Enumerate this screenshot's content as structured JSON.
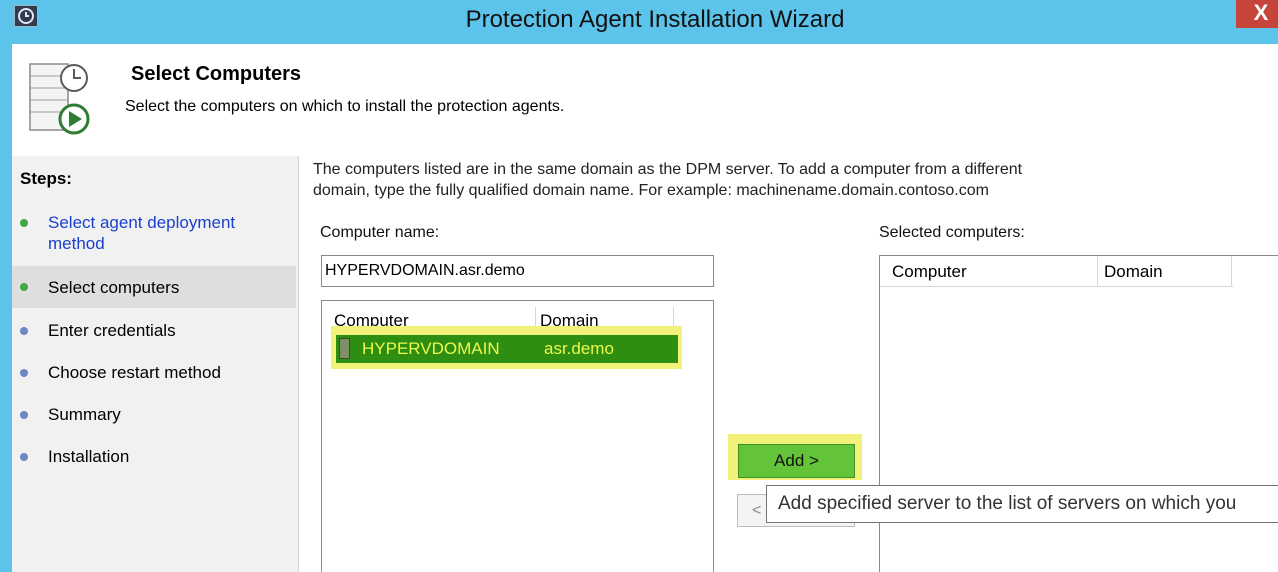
{
  "window": {
    "title": "Protection Agent Installation Wizard",
    "close_glyph": "X"
  },
  "header": {
    "title": "Select Computers",
    "subtitle": "Select the computers on which to install the protection agents."
  },
  "steps": {
    "heading": "Steps:",
    "items": [
      {
        "label": "Select agent deployment method",
        "status": "done"
      },
      {
        "label": "Select computers",
        "status": "current"
      },
      {
        "label": "Enter credentials",
        "status": "pending"
      },
      {
        "label": "Choose restart method",
        "status": "pending"
      },
      {
        "label": "Summary",
        "status": "pending"
      },
      {
        "label": "Installation",
        "status": "pending"
      }
    ]
  },
  "main": {
    "description_line1": "The computers listed are in the same domain as the DPM server. To add a computer from a different",
    "description_line2": "domain, type the fully qualified domain name. For example: machinename.domain.contoso.com",
    "computer_name_label": "Computer name:",
    "computer_name_value": "HYPERVDOMAIN.asr.demo",
    "available_list": {
      "columns": [
        "Computer",
        "Domain"
      ],
      "rows": [
        {
          "computer": "HYPERVDOMAIN",
          "domain": "asr.demo",
          "icon": "server-icon",
          "selected": true
        }
      ]
    },
    "selected_label": "Selected computers:",
    "selected_list": {
      "columns": [
        "Computer",
        "Domain"
      ],
      "rows": []
    },
    "add_button": "Add >",
    "remove_button": "<",
    "tooltip": "Add specified server to the list of servers on which you"
  },
  "colors": {
    "titlebar": "#5cc3ea",
    "selected_row": "#2e8e11",
    "selected_row_text": "#ecf84a",
    "highlight": "#f2f27a",
    "add_button": "#63c43a",
    "step_done": "#3fa83f",
    "step_pending": "#6a87c6",
    "link": "#1a3fcc"
  }
}
